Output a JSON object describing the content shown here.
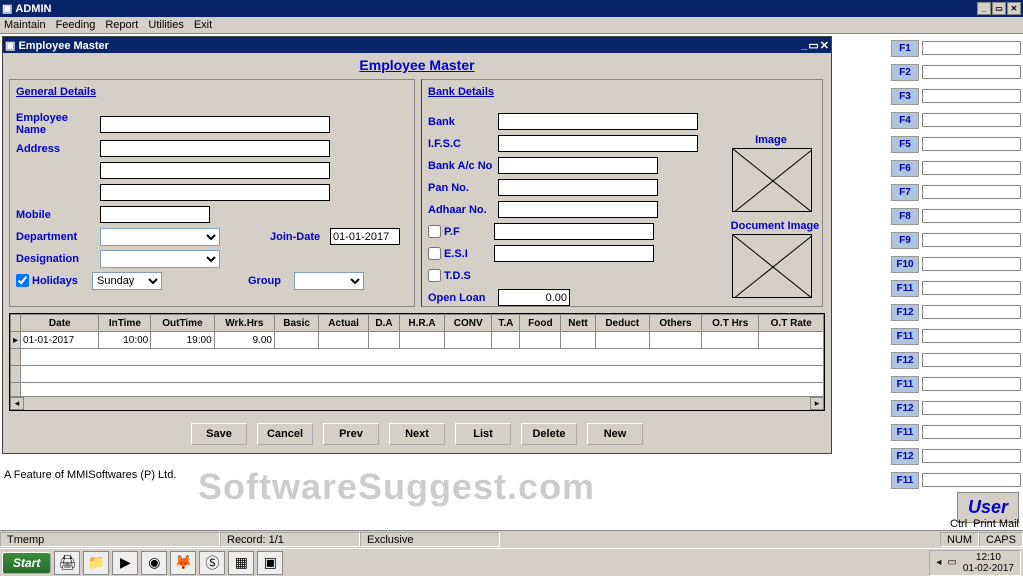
{
  "app": {
    "title": "ADMIN"
  },
  "menu": [
    "Maintain",
    "Feeding",
    "Report",
    "Utilities",
    "Exit"
  ],
  "child_window": {
    "title": "Employee Master"
  },
  "form": {
    "title": "Employee Master",
    "general_section": "General Details",
    "bank_section": "Bank Details",
    "labels": {
      "emp_name": "Employee Name",
      "address": "Address",
      "mobile": "Mobile",
      "department": "Department",
      "designation": "Designation",
      "holidays": "Holidays",
      "join_date": "Join-Date",
      "group": "Group",
      "bank": "Bank",
      "ifsc": "I.F.S.C",
      "bank_ac": "Bank A/c No",
      "pan": "Pan No.",
      "adhaar": "Adhaar No.",
      "pf": "P.F",
      "esi": "E.S.I",
      "tds": "T.D.S",
      "open_loan": "Open Loan",
      "image": "Image",
      "doc_image": "Document Image"
    },
    "values": {
      "holidays_sel": "Sunday",
      "join_date": "01-01-2017",
      "open_loan": "0.00"
    }
  },
  "grid": {
    "headers": [
      "Date",
      "InTime",
      "OutTime",
      "Wrk.Hrs",
      "Basic",
      "Actual",
      "D.A",
      "H.R.A",
      "CONV",
      "T.A",
      "Food",
      "Nett",
      "Deduct",
      "Others",
      "O.T Hrs",
      "O.T Rate"
    ],
    "row": [
      "01-01-2017",
      "10:00",
      "19:00",
      "9.00",
      "",
      "",
      "",
      "",
      "",
      "",
      "",
      "",
      "",
      "",
      "",
      ""
    ]
  },
  "buttons": [
    "Save",
    "Cancel",
    "Prev",
    "Next",
    "List",
    "Delete",
    "New"
  ],
  "fkeys": [
    "F1",
    "F2",
    "F3",
    "F4",
    "F5",
    "F6",
    "F7",
    "F8",
    "F9",
    "F10",
    "F11",
    "F12",
    "F11",
    "F12",
    "F11",
    "F12",
    "F11",
    "F12",
    "F11"
  ],
  "right": {
    "user": "User",
    "ctrl": "Ctrl",
    "printmail": "Print Mail"
  },
  "status": {
    "left": "Tmemp",
    "record": "Record: 1/1",
    "mode": "Exclusive",
    "num": "NUM",
    "caps": "CAPS"
  },
  "feature_line": "A Feature of MMISoftwares (P) Ltd.",
  "taskbar": {
    "start": "Start",
    "time": "12:10",
    "date": "01-02-2017"
  },
  "watermark": "SoftwareSuggest.com"
}
